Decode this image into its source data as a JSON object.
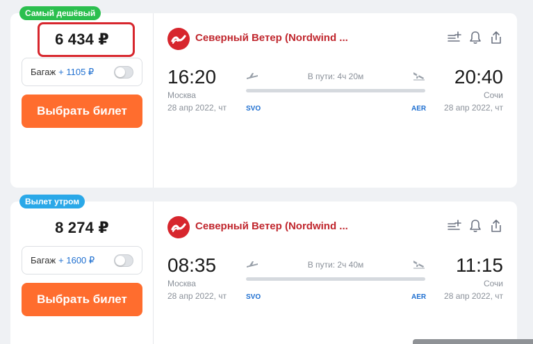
{
  "flights": [
    {
      "badge": "Самый дешёвый",
      "badge_color": "#2bbf4e",
      "price": "6 434 ₽",
      "price_highlighted": true,
      "baggage_label": "Багаж",
      "baggage_price": "+ 1105 ₽",
      "buy_label": "Выбрать билет",
      "airline": "Северный Ветер (Nordwind ...",
      "departure": {
        "time": "16:20",
        "city": "Москва",
        "date": "28 апр 2022, чт",
        "airport": "SVO"
      },
      "arrival": {
        "time": "20:40",
        "city": "Сочи",
        "date": "28 апр 2022, чт",
        "airport": "AER"
      },
      "duration": "В пути: 4ч 20м"
    },
    {
      "badge": "Вылет утром",
      "badge_color": "#2aa8e8",
      "price": "8 274 ₽",
      "price_highlighted": false,
      "baggage_label": "Багаж",
      "baggage_price": "+ 1600 ₽",
      "buy_label": "Выбрать билет",
      "airline": "Северный Ветер (Nordwind ...",
      "departure": {
        "time": "08:35",
        "city": "Москва",
        "date": "28 апр 2022, чт",
        "airport": "SVO"
      },
      "arrival": {
        "time": "11:15",
        "city": "Сочи",
        "date": "28 апр 2022, чт",
        "airport": "AER"
      },
      "duration": "В пути: 2ч 40м"
    }
  ],
  "icons": {
    "add_to_list": "playlist-add-icon",
    "subscribe": "bell-icon",
    "share": "share-icon",
    "takeoff": "takeoff-icon",
    "landing": "landing-icon",
    "airline_logo": "nordwind-logo"
  },
  "colors": {
    "accent": "#ff6d2e",
    "airline": "#c0262d",
    "link": "#1e6fd0",
    "highlight": "#d7262d"
  }
}
